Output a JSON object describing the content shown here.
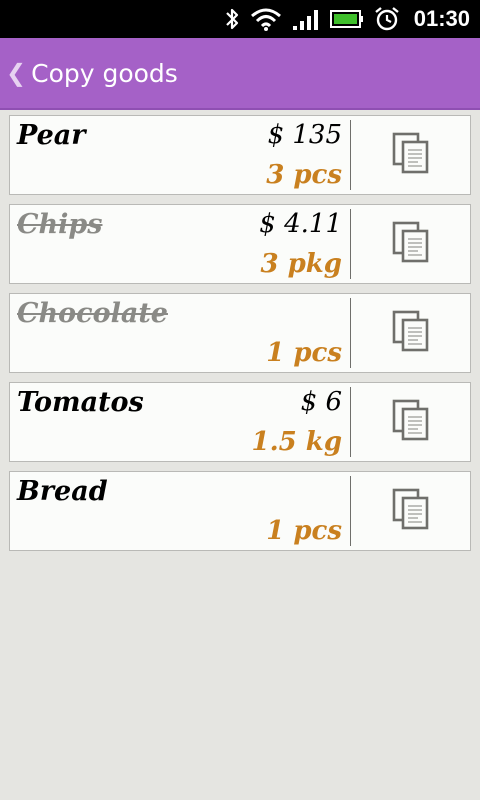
{
  "status_bar": {
    "time": "01:30",
    "icons": [
      "bluetooth-icon",
      "wifi-icon",
      "signal-icon",
      "battery-icon",
      "alarm-icon"
    ],
    "battery_color": "#3fbf2b"
  },
  "header": {
    "title": "Copy goods",
    "back_glyph": "❮",
    "background": "#a561c7"
  },
  "items": [
    {
      "name": "Pear",
      "price": "$ 135",
      "quantity": "3 pcs",
      "done": false
    },
    {
      "name": "Chips",
      "price": "$ 4.11",
      "quantity": "3 pkg",
      "done": true
    },
    {
      "name": "Chocolate",
      "price": "",
      "quantity": "1 pcs",
      "done": true
    },
    {
      "name": "Tomatos",
      "price": "$ 6",
      "quantity": "1.5 kg",
      "done": false
    },
    {
      "name": "Bread",
      "price": "",
      "quantity": "1 pcs",
      "done": false
    }
  ],
  "colors": {
    "quantity": "#c9801f",
    "done_name": "#8a8a86"
  },
  "copy_icon": "copy-icon"
}
